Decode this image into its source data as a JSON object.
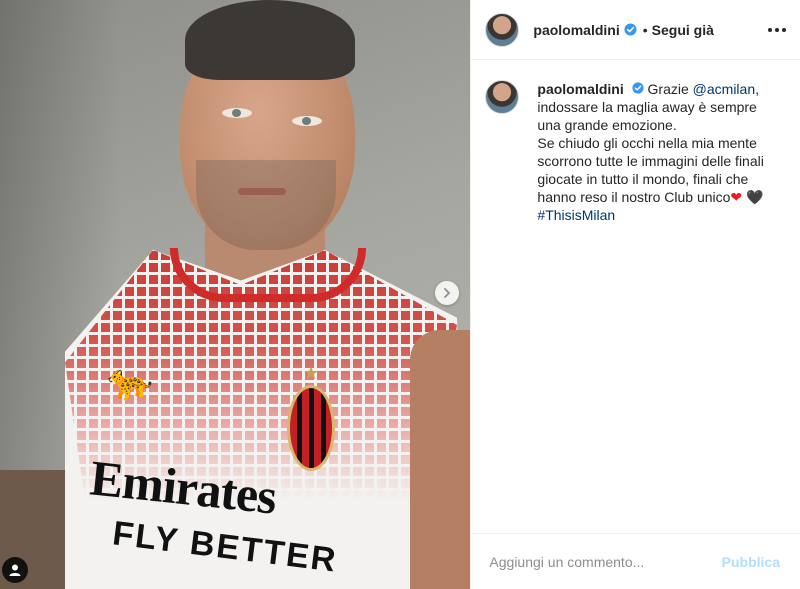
{
  "post": {
    "author": {
      "username": "paolomaldini",
      "verified": true
    },
    "follow_separator": "•",
    "follow_status": "Segui già",
    "media": {
      "jersey_sponsor": "Emirates",
      "jersey_sponsor_tagline": "FLY BETTER",
      "crest_star": "★"
    },
    "caption": {
      "username": "paolomaldini",
      "lines": [
        "Grazie",
        "@acmilan",
        ",",
        "indossare la maglia away è sempre una grande emozione.",
        "Se chiudo gli occhi nella mia mente scorrono tutte le immagini delle finali giocate in tutto il mondo, finali che hanno reso il nostro Club unico",
        "❤",
        "🖤",
        "#ThisisMilan"
      ]
    },
    "comment_box": {
      "placeholder": "Aggiungi un commento...",
      "publish_label": "Pubblica"
    }
  },
  "colors": {
    "verified_blue": "#3897f0",
    "link": "#00376b",
    "publish_disabled": "#b2dffc"
  },
  "icons": {
    "next": "chevron-right-icon",
    "tags": "user-tag-icon",
    "more": "more-options-icon"
  }
}
